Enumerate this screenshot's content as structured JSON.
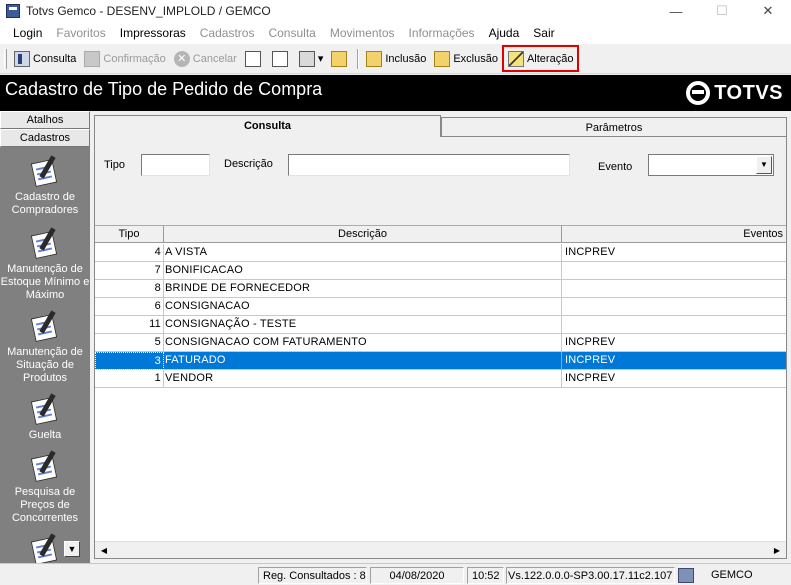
{
  "window": {
    "title": "Totvs Gemco - DESENV_IMPLOLD / GEMCO",
    "minimize": "—",
    "maximize": "☐",
    "close": "✕"
  },
  "menu": [
    {
      "label": "Login",
      "enabled": true
    },
    {
      "label": "Favoritos",
      "enabled": false
    },
    {
      "label": "Impressoras",
      "enabled": true
    },
    {
      "label": "Cadastros",
      "enabled": false
    },
    {
      "label": "Consulta",
      "enabled": false
    },
    {
      "label": "Movimentos",
      "enabled": false
    },
    {
      "label": "Informações",
      "enabled": false
    },
    {
      "label": "Ajuda",
      "enabled": true
    },
    {
      "label": "Sair",
      "enabled": true
    }
  ],
  "toolbar": {
    "consulta": "Consulta",
    "confirmacao": "Confirmação",
    "cancelar": "Cancelar",
    "inclusao": "Inclusão",
    "exclusao": "Exclusão",
    "alteracao": "Alteração",
    "cancel_glyph": "✕",
    "dropdown_glyph": "▾"
  },
  "header": {
    "title": "Cadastro de Tipo de Pedido de Compra",
    "brand": "TOTVS"
  },
  "sidebar": {
    "tab_atalhos": "Atalhos",
    "tab_cadastros": "Cadastros",
    "items": [
      {
        "label": "Cadastro de Compradores"
      },
      {
        "label": "Manutenção de Estoque Mínimo e Máximo"
      },
      {
        "label": "Manutenção de Situação de Produtos"
      },
      {
        "label": "Guelta"
      },
      {
        "label": "Pesquisa de Preços de Concorrentes"
      }
    ],
    "scroll_glyph": "▼"
  },
  "tabs": {
    "consulta": "Consulta",
    "parametros": "Parâmetros"
  },
  "filters": {
    "tipo_label": "Tipo",
    "tipo_value": "",
    "descricao_label": "Descrição",
    "descricao_value": "",
    "evento_label": "Evento",
    "evento_value": "",
    "arrow": "▼"
  },
  "grid": {
    "columns": [
      "Tipo",
      "Descrição",
      "Eventos"
    ],
    "rows": [
      {
        "tipo": "4",
        "descricao": "A VISTA",
        "eventos": "INCPREV",
        "selected": false
      },
      {
        "tipo": "7",
        "descricao": "BONIFICACAO",
        "eventos": "",
        "selected": false
      },
      {
        "tipo": "8",
        "descricao": "BRINDE DE FORNECEDOR",
        "eventos": "",
        "selected": false
      },
      {
        "tipo": "6",
        "descricao": "CONSIGNACAO",
        "eventos": "",
        "selected": false
      },
      {
        "tipo": "11",
        "descricao": "CONSIGNAÇÃO - TESTE",
        "eventos": "",
        "selected": false
      },
      {
        "tipo": "5",
        "descricao": "CONSIGNACAO COM FATURAMENTO",
        "eventos": "INCPREV",
        "selected": false
      },
      {
        "tipo": "3",
        "descricao": "FATURADO",
        "eventos": "INCPREV",
        "selected": true
      },
      {
        "tipo": "1",
        "descricao": "VENDOR",
        "eventos": "INCPREV",
        "selected": false
      }
    ],
    "scroll_left": "◀",
    "scroll_right": "▶"
  },
  "status": {
    "records": "Reg. Consultados : 8",
    "date": "04/08/2020",
    "time": "10:52",
    "version": "Vs.122.0.0.0-SP3.00.17.11c2.107",
    "db": "GEMCO"
  },
  "colors": {
    "selection": "#0078d7",
    "highlight_box": "#e00000",
    "banner": "#000000",
    "sidebar": "#808080"
  }
}
